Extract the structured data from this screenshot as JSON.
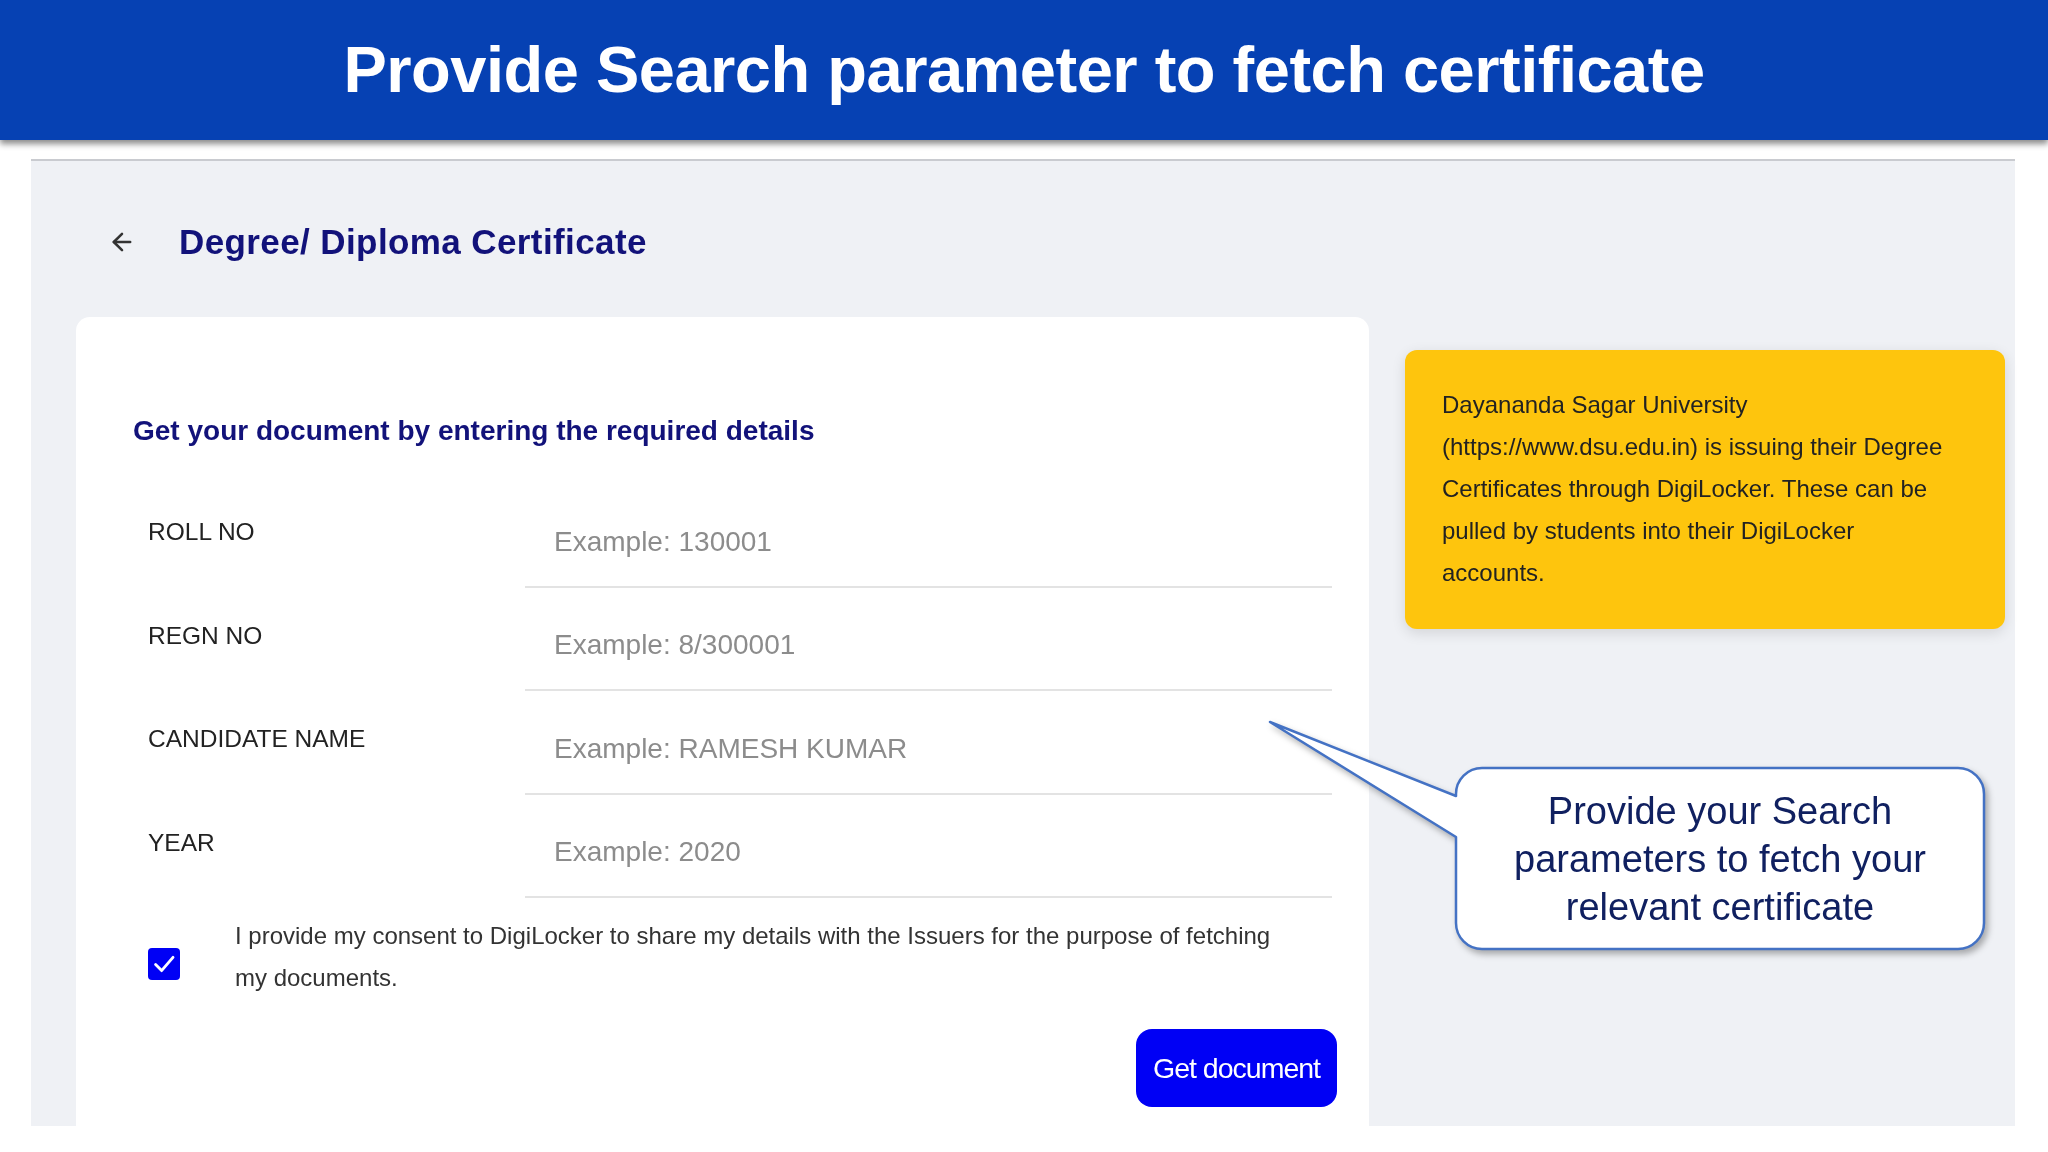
{
  "banner": {
    "title": "Provide Search parameter to fetch certificate"
  },
  "page_header": {
    "title": "Degree/ Diploma Certificate"
  },
  "form": {
    "heading": "Get your document by entering the required details",
    "fields": [
      {
        "label": "ROLL NO",
        "placeholder": "Example: 130001"
      },
      {
        "label": "REGN NO",
        "placeholder": "Example: 8/300001"
      },
      {
        "label": "CANDIDATE NAME",
        "placeholder": "Example: RAMESH KUMAR"
      },
      {
        "label": "YEAR",
        "placeholder": "Example: 2020"
      }
    ],
    "consent": {
      "text": "I provide my consent to DigiLocker to share my details with the Issuers for the purpose of fetching my documents.",
      "checked": true
    },
    "submit_button": {
      "label": "Get document"
    }
  },
  "info_box": {
    "text": "Dayananda Sagar University (https://www.dsu.edu.in) is issuing their Degree Certificates through DigiLocker. These can be pulled by students into their DigiLocker accounts."
  },
  "callout": {
    "text": "Provide your Search parameters to fetch your relevant certificate"
  }
}
